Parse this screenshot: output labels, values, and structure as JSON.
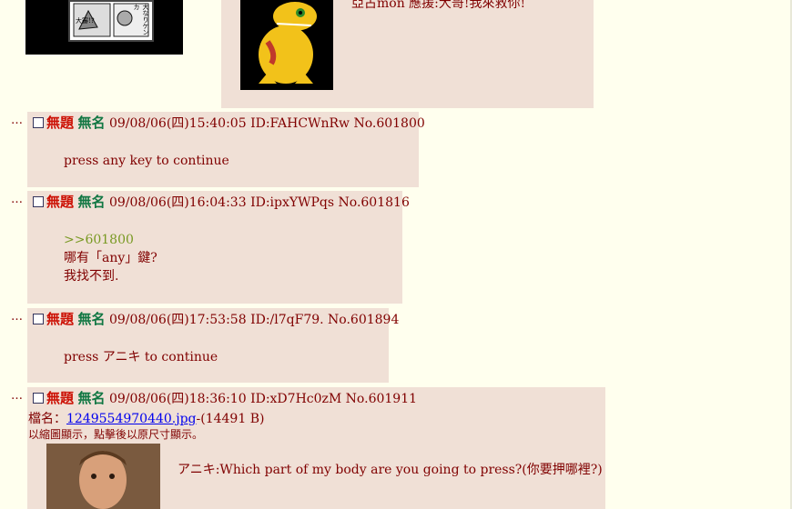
{
  "top": {
    "manga_thumb_text": [
      "大なりケンカ",
      "大審!?"
    ],
    "op_partial_text": "亞古mon 應援:大哥!我來救你!"
  },
  "posts": [
    {
      "dots": "…",
      "subject": "無題",
      "name": "無名",
      "meta": "09/08/06(四)15:40:05 ID:FAHCWnRw No.601800",
      "lines": [
        "press any key to continue"
      ]
    },
    {
      "dots": "…",
      "subject": "無題",
      "name": "無名",
      "meta": "09/08/06(四)16:04:33 ID:ipxYWPqs No.601816",
      "quote": ">>601800",
      "lines": [
        "哪有「any」鍵?",
        "我找不到."
      ]
    },
    {
      "dots": "…",
      "subject": "無題",
      "name": "無名",
      "meta": "09/08/06(四)17:53:58 ID:/l7qF79. No.601894",
      "lines": [
        "press アニキ to continue"
      ]
    },
    {
      "dots": "…",
      "subject": "無題",
      "name": "無名",
      "meta": "09/08/06(四)18:36:10 ID:xD7Hc0zM No.601911",
      "file_label": "檔名：",
      "file_name": "1249554970440.jpg",
      "file_size": "-(14491 B)",
      "file_note": "以縮圖顯示，點擊後以原尺寸顯示。",
      "lines": [
        "アニキ:Which part of my body are you going to press?(你要押哪裡?)"
      ]
    }
  ],
  "colors": {
    "background": "#FFFFEE",
    "reply_bg": "#F0E0D6",
    "subject": "#CC1105",
    "name": "#117743",
    "text": "#800000",
    "quote": "#789922",
    "link": "#0000EE"
  }
}
